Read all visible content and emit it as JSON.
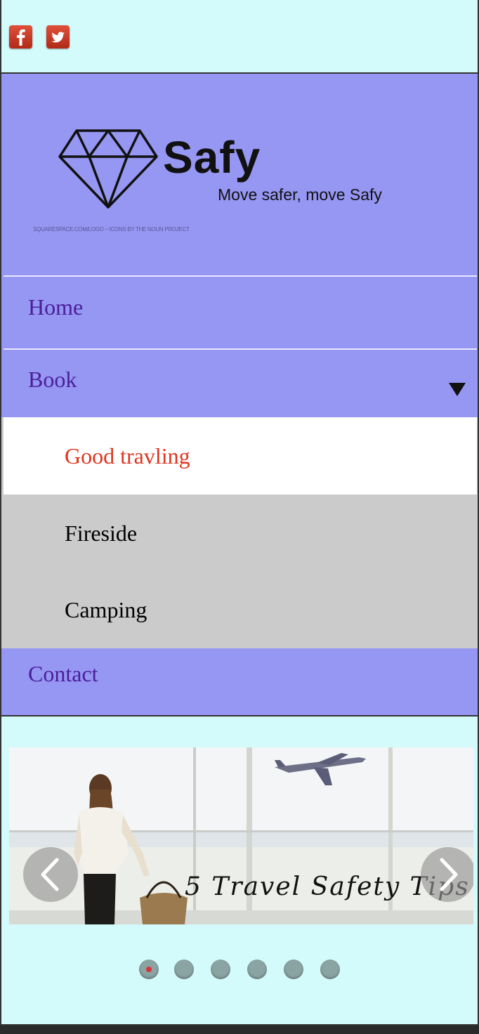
{
  "social": {
    "facebook_icon": "facebook-icon",
    "twitter_icon": "twitter-icon",
    "icon_color": "#c9371f"
  },
  "brand": {
    "name": "Safy",
    "tagline": "Move safer, move Safy",
    "credit": "SQUARESPACE.COM/LOGO – ICONS BY THE NOUN PROJECT",
    "logo_icon": "diamond-icon"
  },
  "nav": {
    "items": [
      {
        "label": "Home"
      },
      {
        "label": "Book",
        "submenu": [
          {
            "label": "Good travling",
            "active": true
          },
          {
            "label": "Fireside"
          },
          {
            "label": "Camping"
          }
        ]
      },
      {
        "label": "Contact"
      }
    ],
    "dropdown_icon": "triangle-down-icon"
  },
  "slider": {
    "caption": "5 Travel Safety Tips",
    "prev_icon": "chevron-left-icon",
    "next_icon": "chevron-right-icon",
    "slide_count": 6,
    "active_slide": 1
  },
  "colors": {
    "page_bg": "#d4fbfc",
    "header_bg": "#9696f3",
    "nav_text": "#4a1f9a",
    "active_sub_text": "#e0341f",
    "submenu_bg": "#cbcbcb"
  }
}
